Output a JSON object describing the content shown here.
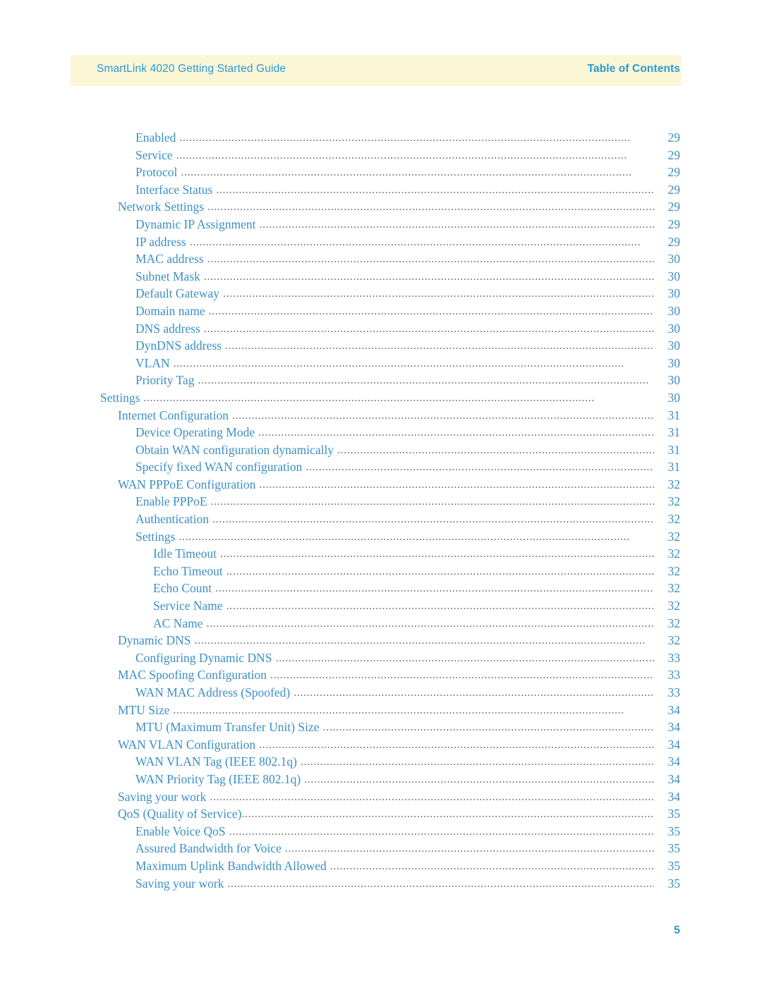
{
  "header": {
    "left_title": "SmartLink 4020 Getting Started Guide",
    "right_title": "Table of Contents"
  },
  "footer": {
    "page_number": "5"
  },
  "toc": {
    "entries": [
      {
        "label": "Enabled",
        "page": "29",
        "level": 2
      },
      {
        "label": "Service",
        "page": "29",
        "level": 2
      },
      {
        "label": "Protocol",
        "page": "29",
        "level": 2
      },
      {
        "label": "Interface Status",
        "page": "29",
        "level": 2
      },
      {
        "label": "Network Settings",
        "page": "29",
        "level": 1
      },
      {
        "label": "Dynamic IP Assignment",
        "page": "29",
        "level": 2
      },
      {
        "label": "IP address",
        "page": "29",
        "level": 2
      },
      {
        "label": "MAC address",
        "page": "30",
        "level": 2
      },
      {
        "label": "Subnet Mask",
        "page": "30",
        "level": 2
      },
      {
        "label": "Default Gateway",
        "page": "30",
        "level": 2
      },
      {
        "label": "Domain name",
        "page": "30",
        "level": 2
      },
      {
        "label": "DNS address",
        "page": "30",
        "level": 2
      },
      {
        "label": "DynDNS address",
        "page": "30",
        "level": 2
      },
      {
        "label": "VLAN",
        "page": "30",
        "level": 2
      },
      {
        "label": "Priority Tag",
        "page": "30",
        "level": 2
      },
      {
        "label": "Settings",
        "page": "30",
        "level": 0
      },
      {
        "label": "Internet Configuration",
        "page": "31",
        "level": 1
      },
      {
        "label": "Device Operating Mode",
        "page": "31",
        "level": 2
      },
      {
        "label": "Obtain WAN configuration dynamically",
        "page": "31",
        "level": 2
      },
      {
        "label": "Specify fixed WAN configuration",
        "page": "31",
        "level": 2
      },
      {
        "label": "WAN PPPoE Configuration",
        "page": "32",
        "level": 1
      },
      {
        "label": "Enable PPPoE",
        "page": "32",
        "level": 2
      },
      {
        "label": "Authentication",
        "page": "32",
        "level": 2
      },
      {
        "label": "Settings",
        "page": "32",
        "level": 2
      },
      {
        "label": "Idle Timeout",
        "page": "32",
        "level": 3
      },
      {
        "label": "Echo Timeout",
        "page": "32",
        "level": 3
      },
      {
        "label": "Echo Count",
        "page": "32",
        "level": 3
      },
      {
        "label": "Service Name",
        "page": "32",
        "level": 3
      },
      {
        "label": "AC Name",
        "page": "32",
        "level": 3
      },
      {
        "label": "Dynamic DNS",
        "page": "32",
        "level": 1
      },
      {
        "label": "Configuring Dynamic DNS",
        "page": "33",
        "level": 2
      },
      {
        "label": "MAC Spoofing Configuration",
        "page": "33",
        "level": 1
      },
      {
        "label": "WAN MAC Address (Spoofed)",
        "page": "33",
        "level": 2
      },
      {
        "label": "MTU Size",
        "page": "34",
        "level": 1
      },
      {
        "label": "MTU (Maximum Transfer Unit) Size",
        "page": "34",
        "level": 2
      },
      {
        "label": "WAN VLAN Configuration",
        "page": "34",
        "level": 1
      },
      {
        "label": "WAN VLAN Tag (IEEE 802.1q)",
        "page": "34",
        "level": 2
      },
      {
        "label": "WAN Priority Tag (IEEE 802.1q)",
        "page": "34",
        "level": 2
      },
      {
        "label": "Saving your work",
        "page": "34",
        "level": 1
      },
      {
        "label": "QoS (Quality of Service)",
        "page": "35",
        "level": 1,
        "tight": true
      },
      {
        "label": "Enable Voice QoS",
        "page": "35",
        "level": 2
      },
      {
        "label": "Assured Bandwidth for Voice",
        "page": "35",
        "level": 2
      },
      {
        "label": "Maximum Uplink Bandwidth Allowed",
        "page": "35",
        "level": 2
      },
      {
        "label": "Saving your work",
        "page": "35",
        "level": 2
      }
    ]
  }
}
